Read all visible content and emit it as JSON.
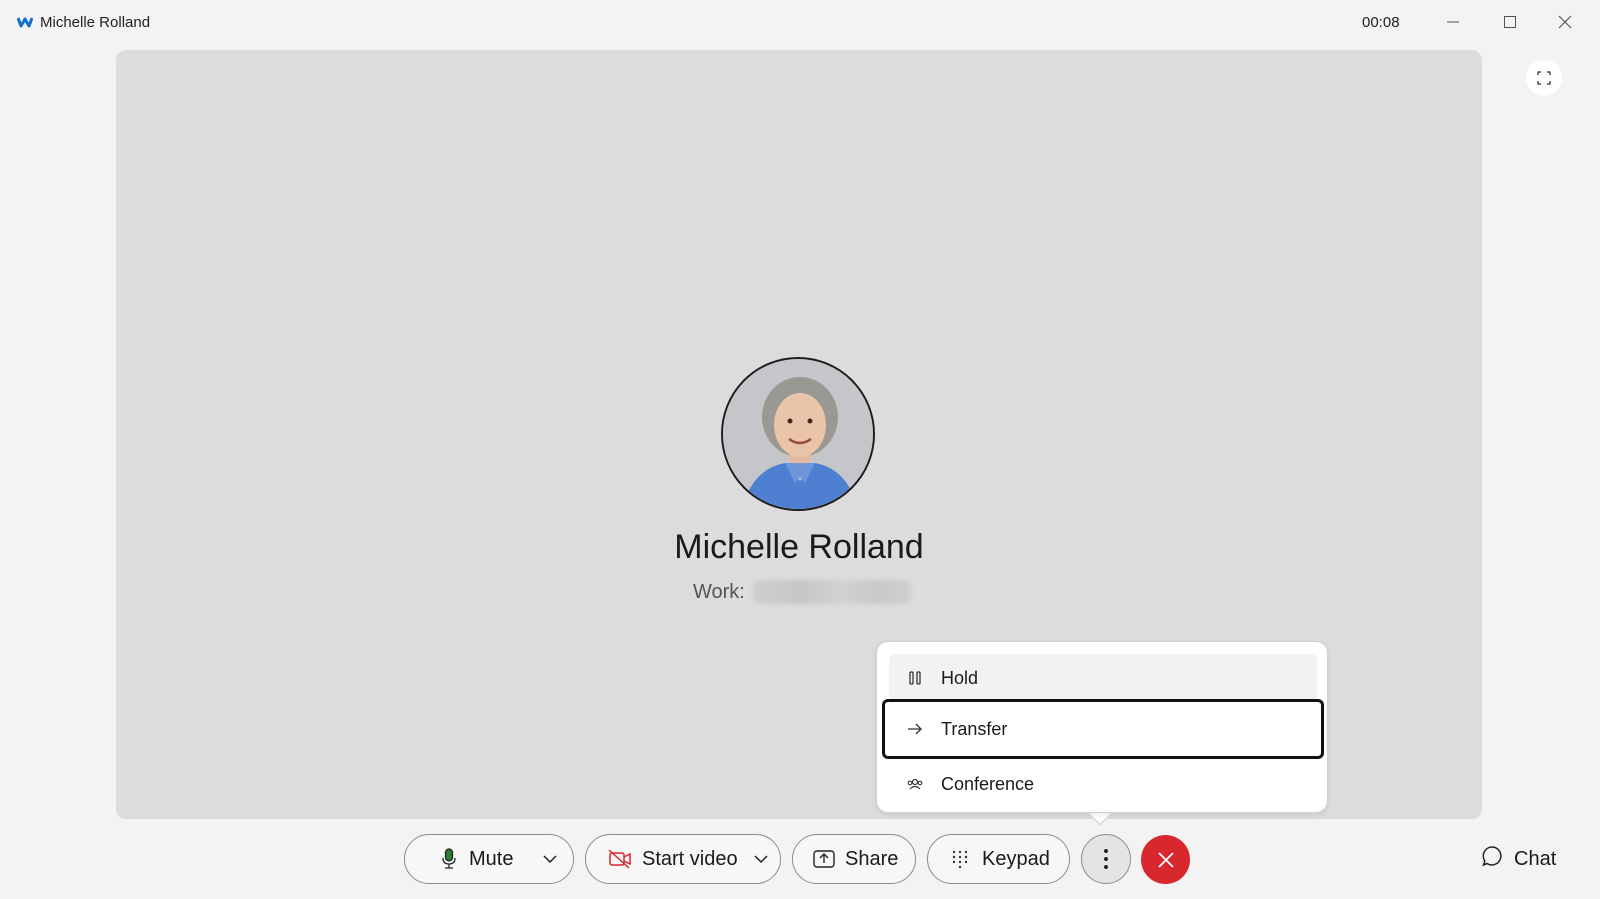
{
  "window": {
    "title": "Michelle Rolland",
    "timer": "00:08"
  },
  "contact": {
    "name": "Michelle Rolland",
    "number_label": "Work:"
  },
  "menu": {
    "items": [
      {
        "label": "Hold",
        "icon": "pause-icon"
      },
      {
        "label": "Transfer",
        "icon": "arrow-right-icon"
      },
      {
        "label": "Conference",
        "icon": "conference-icon"
      }
    ]
  },
  "controls": {
    "mute_label": "Mute",
    "video_label": "Start video",
    "share_label": "Share",
    "keypad_label": "Keypad",
    "chat_label": "Chat"
  },
  "colors": {
    "end_call": "#d9272e",
    "stage_bg": "#dcdcdc",
    "app_accent": "#1170cf"
  }
}
